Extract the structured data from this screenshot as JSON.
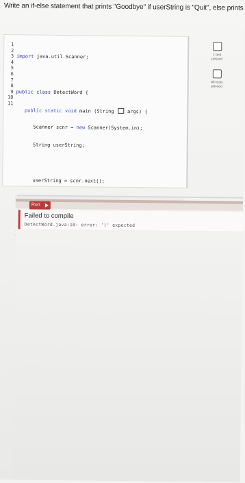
{
  "prompt": "Write an if-else statement that prints \"Goodbye\" if userString is \"Quit\", else prints \"Hello\". End with newline.",
  "editor": {
    "line_numbers": [
      "1",
      "2",
      "3",
      "4",
      "5",
      "6",
      "7",
      "8",
      "9",
      "10",
      "11"
    ],
    "code": {
      "l1_kw": "import",
      "l1_rest": " java.util.Scanner;",
      "l3_kw": "public class",
      "l3_rest": " DetectWord {",
      "l4_kw": "   public static void",
      "l4_rest_a": " main (String ",
      "l4_rest_b": " args) {",
      "l5_a": "      Scanner scnr = ",
      "l5_kw": "new",
      "l5_b": " Scanner(System.in);",
      "l6": "      String userString;",
      "l8": "      userString = scnr.next();",
      "l10": "   }",
      "l11": "}"
    }
  },
  "checks": [
    {
      "label_1": "1 test",
      "label_2": "passed"
    },
    {
      "label_1": "All tests",
      "label_2": "passed"
    }
  ],
  "run": {
    "label": "Run"
  },
  "result": {
    "title": "Failed to compile",
    "detail": "DetectWord.java:10: error: ')' expected"
  }
}
